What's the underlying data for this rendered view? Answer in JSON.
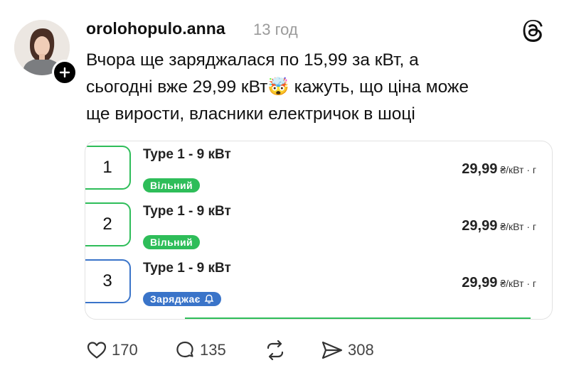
{
  "post": {
    "username": "orolohopulo.anna",
    "time": "13 год",
    "text_lines": [
      "Вчора ще заряджалася по 15,99 за кВт, а",
      "сьогодні вже 29,99 кВт🤯 кажуть, що ціна може",
      "ще вирости, власники електричок в шоці"
    ]
  },
  "card": {
    "rows": [
      {
        "number": "1",
        "title": "Type 1 - 9 кВт",
        "status": "Вільний",
        "price": "29,99",
        "unit": "₴/кВт · г"
      },
      {
        "number": "2",
        "title": "Type 1 - 9 кВт",
        "status": "Вільний",
        "price": "29,99",
        "unit": "₴/кВт · г"
      },
      {
        "number": "3",
        "title": "Type 1 - 9 кВт",
        "status": "Заряджає",
        "price": "29,99",
        "unit": "₴/кВт · г"
      }
    ]
  },
  "actions": {
    "likes": "170",
    "comments": "135",
    "shares": "308"
  },
  "icons": {
    "follow": "plus-icon",
    "brand": "threads-logo-icon",
    "like": "heart-icon",
    "comment": "comment-icon",
    "repost": "repost-icon",
    "share": "send-icon",
    "notify": "bell-icon"
  },
  "colors": {
    "free": "#2ebd59",
    "charging": "#3a74c9",
    "muted": "#9a9a9a"
  }
}
